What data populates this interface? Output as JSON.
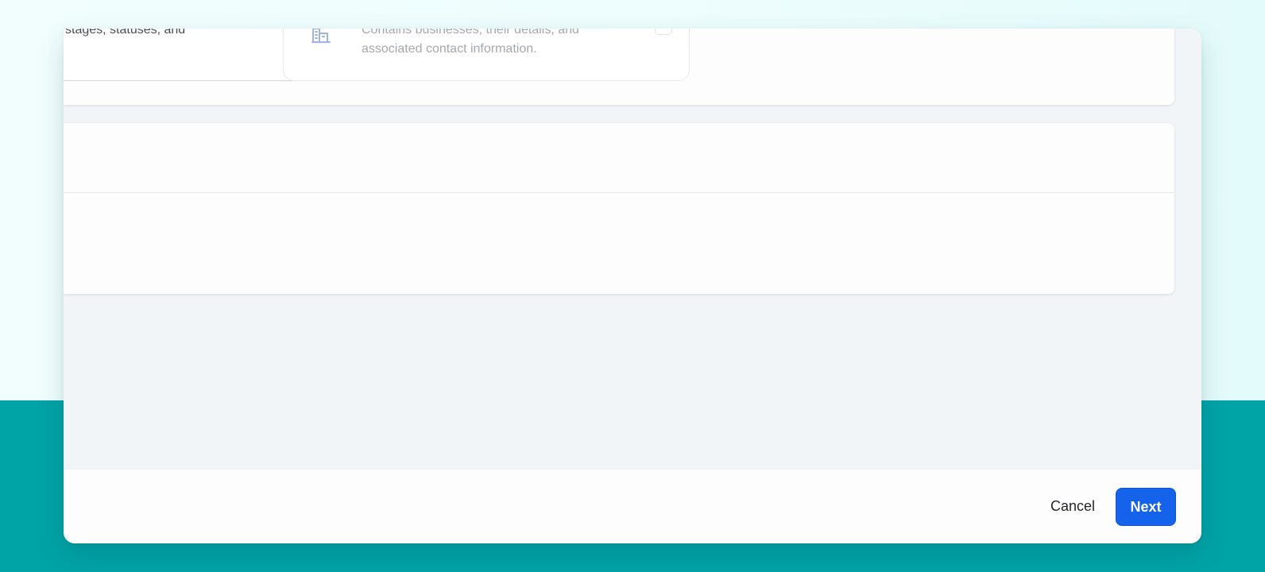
{
  "cards": [
    {
      "description": "stages, statuses, and",
      "selected": false
    },
    {
      "icon": "building-icon",
      "description": "Contains businesses, their details, and associated contact information.",
      "selected": false
    }
  ],
  "footer": {
    "cancel_label": "Cancel",
    "next_label": "Next"
  },
  "colors": {
    "page_top": "#effeff",
    "page_bottom": "#00a3a6",
    "primary": "#1463ea",
    "modal_bg": "#f1f5f8"
  }
}
